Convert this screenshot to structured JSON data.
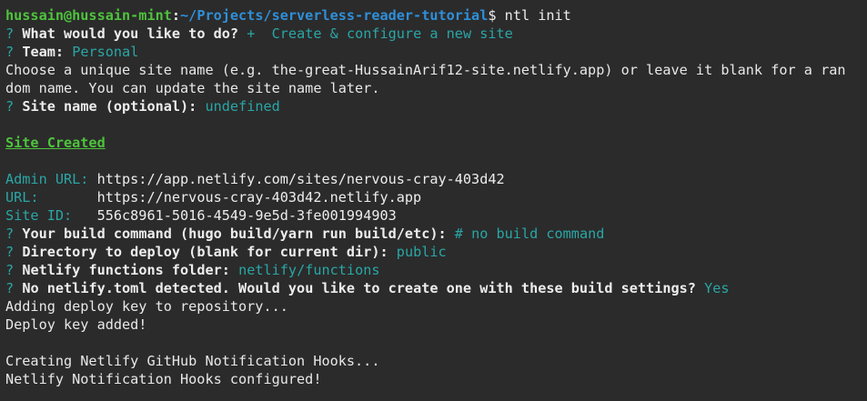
{
  "prompt": {
    "user_host": "hussain@hussain-mint",
    "sep": ":",
    "path": "~/Projects/serverless-reader-tutorial",
    "symbol": "$",
    "command": "ntl init"
  },
  "lines": {
    "q1_mark": "?",
    "q1_label": "What would you like to do?",
    "q1_answer": "+  Create & configure a new site",
    "q2_mark": "?",
    "q2_label": "Team:",
    "q2_answer": "Personal",
    "info1": "Choose a unique site name (e.g. the-great-HussainArif12-site.netlify.app) or leave it blank for a ran",
    "info2": "dom name. You can update the site name later.",
    "q3_mark": "?",
    "q3_label": "Site name (optional):",
    "q3_answer": "undefined",
    "site_created": "Site Created",
    "admin_key": "Admin URL:",
    "admin_val": "https://app.netlify.com/sites/nervous-cray-403d42",
    "url_key": "URL:",
    "url_val": "https://nervous-cray-403d42.netlify.app",
    "siteid_key": "Site ID:",
    "siteid_val": "556c8961-5016-4549-9e5d-3fe001994903",
    "q4_mark": "?",
    "q4_label": "Your build command (hugo build/yarn run build/etc):",
    "q4_answer": "# no build command",
    "q5_mark": "?",
    "q5_label": "Directory to deploy (blank for current dir):",
    "q5_answer": "public",
    "q6_mark": "?",
    "q6_label": "Netlify functions folder:",
    "q6_answer": "netlify/functions",
    "q7_mark": "?",
    "q7_label": "No netlify.toml detected. Would you like to create one with these build settings?",
    "q7_answer": "Yes",
    "out1": "Adding deploy key to repository...",
    "out2": "Deploy key added!",
    "out3": "Creating Netlify GitHub Notification Hooks...",
    "out4": "Netlify Notification Hooks configured!"
  },
  "colors": {
    "background": "#2b2b2b",
    "foreground": "#e8e8e8",
    "prompt_user": "#4ec33d",
    "prompt_path": "#2f8fd8",
    "answer": "#2aa6a6"
  }
}
